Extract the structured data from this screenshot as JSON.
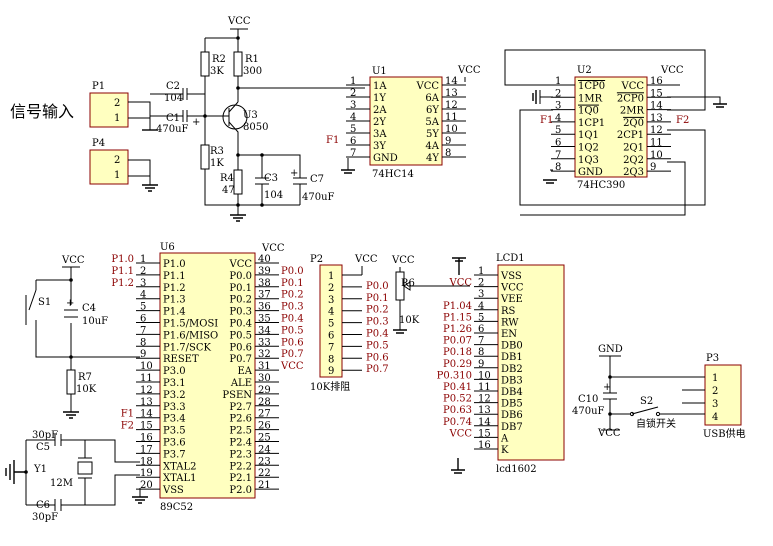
{
  "input_label": "信号输入",
  "vcc": "VCC",
  "gnd": "GND",
  "connectors": {
    "p1": {
      "ref": "P1",
      "pins": [
        "2",
        "1"
      ]
    },
    "p4": {
      "ref": "P4",
      "pins": [
        "2",
        "1"
      ]
    },
    "p2": {
      "ref": "P2",
      "pins": [
        "1",
        "2",
        "3",
        "4",
        "5",
        "6",
        "7",
        "8",
        "9"
      ],
      "caption": "10K排阻"
    },
    "p3": {
      "ref": "P3",
      "pins": [
        "1",
        "2",
        "3",
        "4"
      ],
      "caption": "USB供电"
    }
  },
  "passives": {
    "r1": {
      "ref": "R1",
      "value": "300"
    },
    "r2": {
      "ref": "R2",
      "value": "3K"
    },
    "r3": {
      "ref": "R3",
      "value": "1K"
    },
    "r4": {
      "ref": "R4",
      "value": "47"
    },
    "r6": {
      "ref": "R6",
      "value": "10K"
    },
    "r7": {
      "ref": "R7",
      "value": "10K"
    },
    "c1": {
      "ref": "C1",
      "value": "470uF"
    },
    "c2": {
      "ref": "C2",
      "value": "104"
    },
    "c3": {
      "ref": "C3",
      "value": "104"
    },
    "c4": {
      "ref": "C4",
      "value": "10uF"
    },
    "c5": {
      "ref": "C5",
      "value": "30pF"
    },
    "c6": {
      "ref": "C6",
      "value": "30pF"
    },
    "c7": {
      "ref": "C7",
      "value": "470uF"
    },
    "c10": {
      "ref": "C10",
      "value": "470uF"
    },
    "y1": {
      "ref": "Y1",
      "value": "12M"
    },
    "u3": {
      "ref": "U3",
      "value": "8050"
    },
    "s1": {
      "ref": "S1"
    },
    "s2": {
      "ref": "S2",
      "caption": "自锁开关"
    }
  },
  "u1": {
    "ref": "U1",
    "part": "74HC14",
    "left": [
      [
        "1",
        "1A"
      ],
      [
        "2",
        "1Y"
      ],
      [
        "3",
        "2A"
      ],
      [
        "4",
        "2Y"
      ],
      [
        "5",
        "3A"
      ],
      [
        "6",
        "3Y"
      ],
      [
        "7",
        "GND"
      ]
    ],
    "right": [
      [
        "14",
        "VCC"
      ],
      [
        "13",
        "6A"
      ],
      [
        "12",
        "6Y"
      ],
      [
        "11",
        "5A"
      ],
      [
        "10",
        "5Y"
      ],
      [
        "9",
        "4A"
      ],
      [
        "8",
        "4Y"
      ]
    ],
    "net": "F1"
  },
  "u2": {
    "ref": "U2",
    "part": "74HC390",
    "left": [
      [
        "1",
        "1CP0"
      ],
      [
        "2",
        "1MR"
      ],
      [
        "3",
        "1Q0"
      ],
      [
        "4",
        "1CP1"
      ],
      [
        "5",
        "1Q1"
      ],
      [
        "6",
        "1Q2"
      ],
      [
        "7",
        "1Q3"
      ],
      [
        "8",
        "GND"
      ]
    ],
    "right": [
      [
        "16",
        "VCC"
      ],
      [
        "15",
        "2CP0"
      ],
      [
        "14",
        "2MR"
      ],
      [
        "13",
        "2Q0"
      ],
      [
        "12",
        "2CP1"
      ],
      [
        "11",
        "2Q1"
      ],
      [
        "10",
        "2Q2"
      ],
      [
        "9",
        "2Q3"
      ]
    ],
    "nets": [
      "F1",
      "F2"
    ]
  },
  "u6": {
    "ref": "U6",
    "part": "89C52",
    "left": [
      [
        "1",
        "P1.0"
      ],
      [
        "2",
        "P1.1"
      ],
      [
        "3",
        "P1.2"
      ],
      [
        "4",
        "P1.3"
      ],
      [
        "5",
        "P1.4"
      ],
      [
        "6",
        "P1.5/MOSI"
      ],
      [
        "7",
        "P1.6/MISO"
      ],
      [
        "8",
        "P1.7/SCK"
      ],
      [
        "9",
        "RESET"
      ],
      [
        "10",
        "P3.0"
      ],
      [
        "11",
        "P3.1"
      ],
      [
        "12",
        "P3.2"
      ],
      [
        "13",
        "P3.3"
      ],
      [
        "14",
        "P3.4"
      ],
      [
        "15",
        "P3.5"
      ],
      [
        "16",
        "P3.6"
      ],
      [
        "17",
        "P3.7"
      ],
      [
        "18",
        "XTAL2"
      ],
      [
        "19",
        "XTAL1"
      ],
      [
        "20",
        "VSS"
      ]
    ],
    "right": [
      [
        "40",
        "VCC"
      ],
      [
        "39",
        "P0.0"
      ],
      [
        "38",
        "P0.1"
      ],
      [
        "37",
        "P0.2"
      ],
      [
        "36",
        "P0.3"
      ],
      [
        "35",
        "P0.4"
      ],
      [
        "34",
        "P0.5"
      ],
      [
        "33",
        "P0.6"
      ],
      [
        "32",
        "P0.7"
      ],
      [
        "31",
        "EA"
      ],
      [
        "30",
        "ALE"
      ],
      [
        "29",
        "PSEN"
      ],
      [
        "28",
        "P2.7"
      ],
      [
        "27",
        "P2.6"
      ],
      [
        "26",
        "P2.5"
      ],
      [
        "25",
        "P2.4"
      ],
      [
        "24",
        "P2.3"
      ],
      [
        "23",
        "P2.2"
      ],
      [
        "22",
        "P2.1"
      ],
      [
        "21",
        "P2.0"
      ]
    ],
    "left_nets": [
      "P1.0",
      "P1.1",
      "P1.2",
      "",
      "",
      "",
      "",
      "",
      "",
      "",
      "",
      "",
      "",
      "F1",
      "F2",
      "",
      "",
      "",
      "",
      ""
    ],
    "right_nets": [
      "",
      "P0.0",
      "P0.1",
      "P0.2",
      "P0.3",
      "P0.4",
      "P0.5",
      "P0.6",
      "P0.7",
      "VCC",
      "",
      "",
      "",
      "",
      "",
      "",
      "",
      "",
      "",
      ""
    ]
  },
  "p2_nets": [
    "",
    "P0.0",
    "P0.1",
    "P0.2",
    "P0.3",
    "P0.4",
    "P0.5",
    "P0.6",
    "P0.7"
  ],
  "lcd": {
    "ref": "LCD1",
    "part": "lcd1602",
    "pins": [
      [
        "1",
        "VSS"
      ],
      [
        "2",
        "VCC"
      ],
      [
        "3",
        "VEE"
      ],
      [
        "4",
        "RS"
      ],
      [
        "5",
        "RW"
      ],
      [
        "6",
        "EN"
      ],
      [
        "7",
        "DB0"
      ],
      [
        "8",
        "DB1"
      ],
      [
        "9",
        "DB2"
      ],
      [
        "10",
        "DB3"
      ],
      [
        "11",
        "DB4"
      ],
      [
        "12",
        "DB5"
      ],
      [
        "13",
        "DB6"
      ],
      [
        "14",
        "DB7"
      ],
      [
        "15",
        "A"
      ],
      [
        "16",
        "K"
      ]
    ],
    "nets": [
      "",
      "VCC",
      "",
      "P1.04",
      "P1.15",
      "P1.26",
      "P0.07",
      "P0.18",
      "P0.29",
      "P0.310",
      "P0.41",
      "P0.52",
      "P0.63",
      "P0.74",
      "VCC",
      ""
    ]
  }
}
